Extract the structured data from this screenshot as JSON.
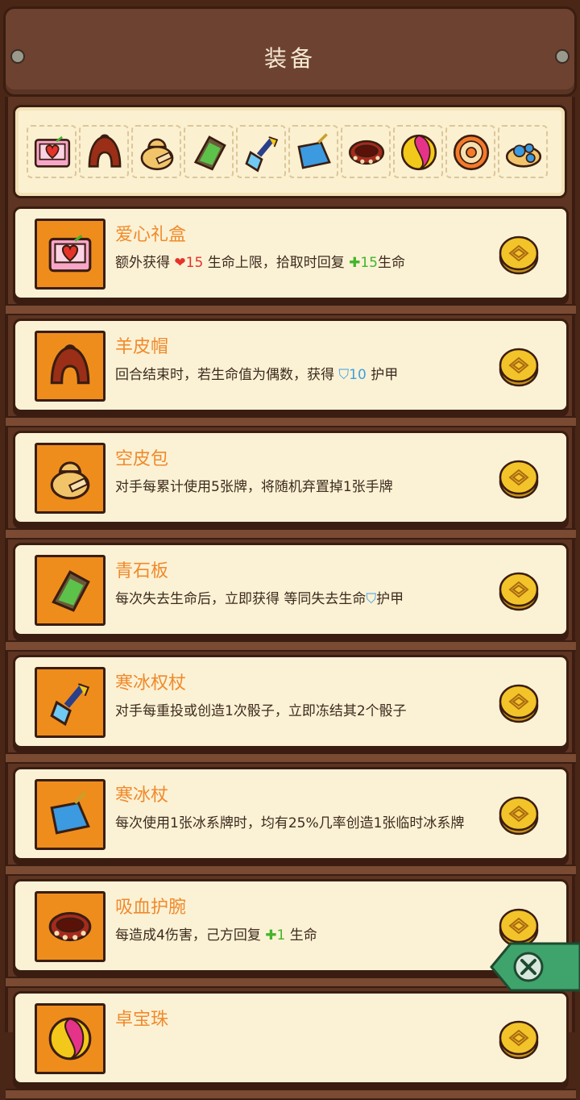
{
  "header": {
    "title": "装备"
  },
  "strip": {
    "icons": [
      "heart-gift-box-icon",
      "sheepskin-hat-icon",
      "empty-leather-bag-icon",
      "green-stone-slab-icon",
      "frost-scepter-icon",
      "frost-staff-icon",
      "vampire-bracer-icon",
      "swirl-orb-icon",
      "donut-ring-icon",
      "blue-mushroom-icon"
    ]
  },
  "items": [
    {
      "name": "爱心礼盒",
      "icon": "heart-gift-box-icon",
      "desc": [
        {
          "t": "额外获得 "
        },
        {
          "t": "❤",
          "c": "red"
        },
        {
          "t": "15",
          "c": "red"
        },
        {
          "t": " 生命上限，拾取时回复 "
        },
        {
          "t": "✚",
          "c": "green"
        },
        {
          "t": "15",
          "c": "green"
        },
        {
          "t": "生命"
        }
      ]
    },
    {
      "name": "羊皮帽",
      "icon": "sheepskin-hat-icon",
      "desc": [
        {
          "t": "回合结束时，若生命值为偶数，获得 "
        },
        {
          "t": "⛉",
          "c": "blue"
        },
        {
          "t": "10",
          "c": "blue"
        },
        {
          "t": " 护甲"
        }
      ]
    },
    {
      "name": "空皮包",
      "icon": "empty-leather-bag-icon",
      "desc": [
        {
          "t": "对手每累计使用5张牌，将随机弃置掉1张手牌"
        }
      ]
    },
    {
      "name": "青石板",
      "icon": "green-stone-slab-icon",
      "desc": [
        {
          "t": "每次失去生命后，立即获得 等同失去生命"
        },
        {
          "t": "⛉",
          "c": "blue"
        },
        {
          "t": "护甲"
        }
      ]
    },
    {
      "name": "寒冰权杖",
      "icon": "frost-scepter-icon",
      "desc": [
        {
          "t": "对手每重投或创造1次骰子，立即冻结其2个骰子"
        }
      ]
    },
    {
      "name": "寒冰杖",
      "icon": "frost-staff-icon",
      "desc": [
        {
          "t": "每次使用1张冰系牌时，均有25%几率创造1张临时冰系牌"
        }
      ]
    },
    {
      "name": "吸血护腕",
      "icon": "vampire-bracer-icon",
      "desc": [
        {
          "t": "每造成4伤害，己方回复 "
        },
        {
          "t": "✚",
          "c": "green"
        },
        {
          "t": "1",
          "c": "green"
        },
        {
          "t": " 生命"
        }
      ]
    },
    {
      "name": "卓宝珠",
      "icon": "swirl-orb-icon",
      "desc": []
    }
  ],
  "colors": {
    "accent": "#f08a2b",
    "card_bg": "#fbf2d6",
    "frame": "#5e3422",
    "close_button": "#3fa36c"
  }
}
